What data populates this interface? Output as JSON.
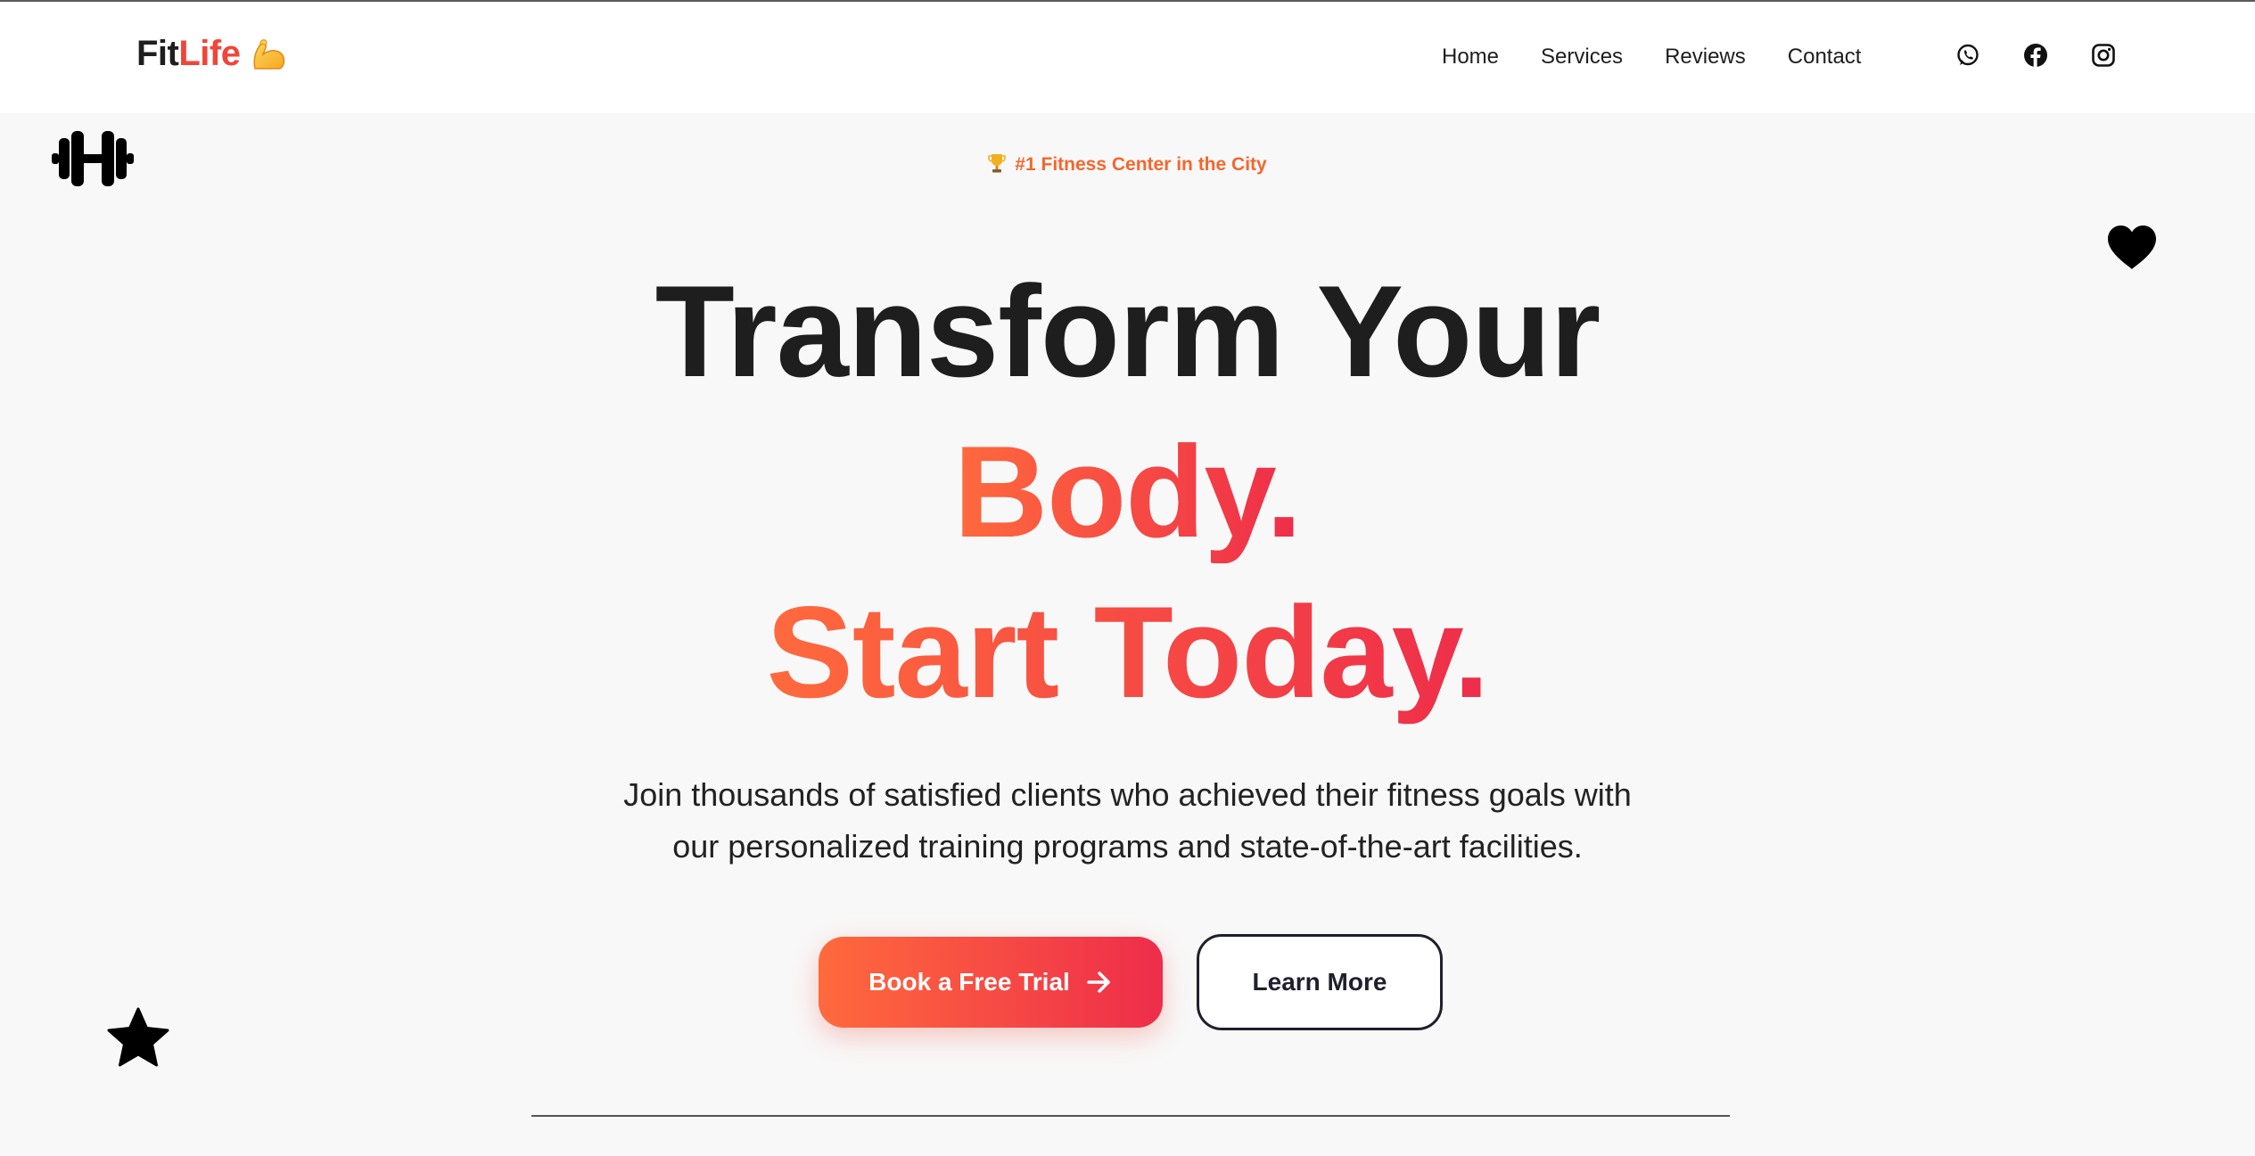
{
  "header": {
    "logo_part1": "Fit",
    "logo_part2": "Life",
    "logo_emoji": "flexed-biceps-icon",
    "nav": [
      {
        "label": "Home"
      },
      {
        "label": "Services"
      },
      {
        "label": "Reviews"
      },
      {
        "label": "Contact"
      }
    ],
    "social": [
      "whatsapp-icon",
      "facebook-icon",
      "instagram-icon"
    ]
  },
  "hero": {
    "badge": "#1 Fitness Center in the City",
    "badge_icon": "trophy-icon",
    "headline_line1": "Transform Your",
    "headline_line2": "Body.",
    "headline_line3": "Start Today.",
    "subtitle_line1": "Join thousands of satisfied clients who achieved their fitness goals with",
    "subtitle_line2": "our personalized training programs and state-of-the-art facilities.",
    "primary_button": "Book a Free Trial",
    "secondary_button": "Learn More"
  },
  "decor": {
    "icons": [
      "dumbbell-icon",
      "heart-icon",
      "star-icon"
    ]
  },
  "colors": {
    "accent_start": "#ff6a3d",
    "accent_end": "#ee2d4a",
    "badge": "#f3672d",
    "text_dark": "#1e1e1e",
    "background": "#f8f8f8"
  }
}
